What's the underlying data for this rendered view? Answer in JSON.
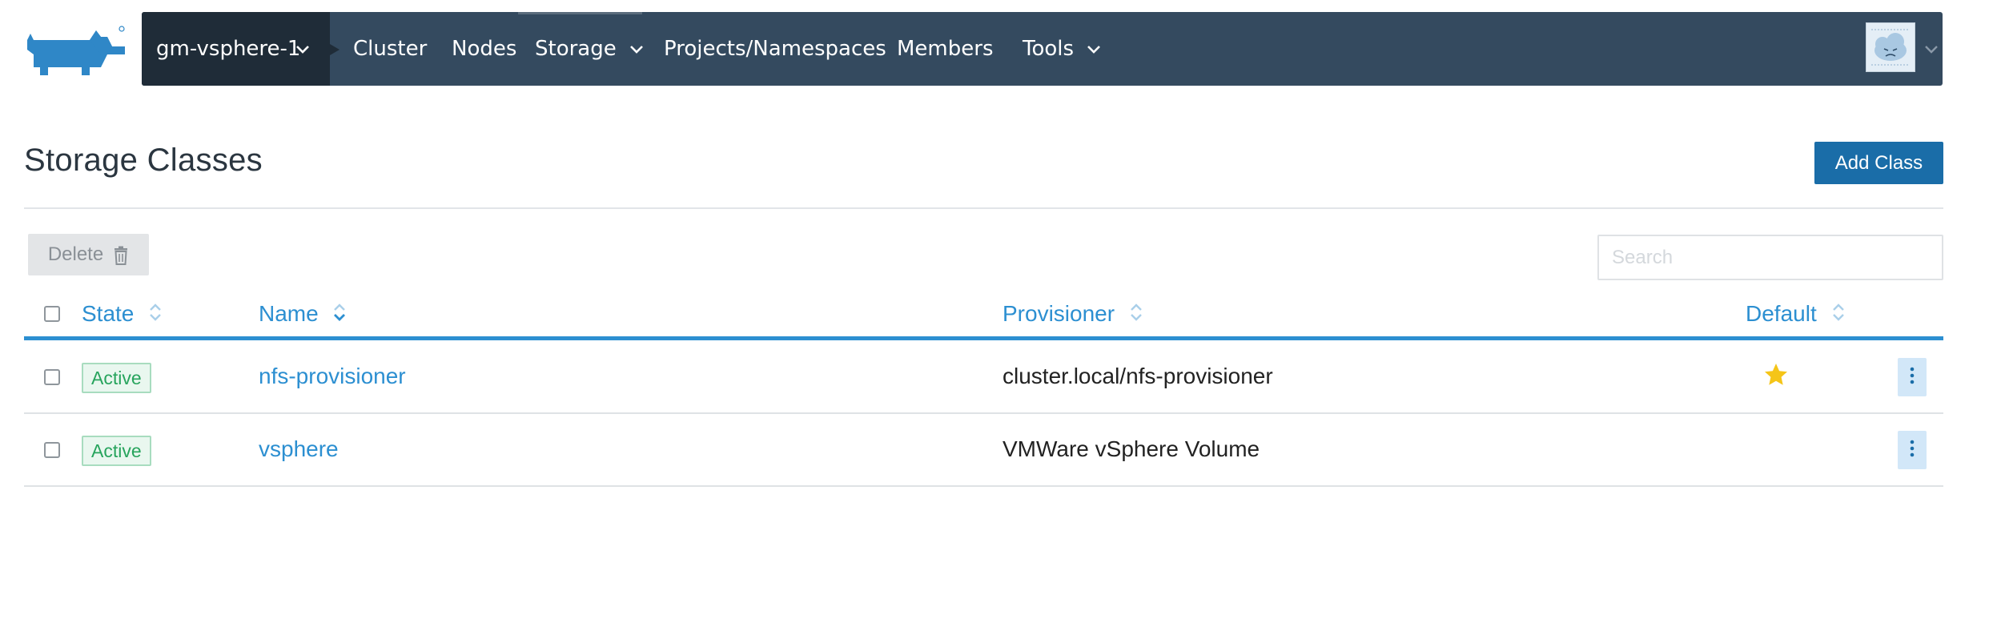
{
  "nav": {
    "cluster": "gm-vsphere-1",
    "items": [
      "Cluster",
      "Nodes",
      "Storage",
      "Projects/Namespaces",
      "Members",
      "Tools"
    ]
  },
  "page": {
    "title": "Storage Classes",
    "add_button": "Add Class",
    "delete_button": "Delete",
    "search_placeholder": "Search"
  },
  "table": {
    "columns": [
      "State",
      "Name",
      "Provisioner",
      "Default"
    ],
    "rows": [
      {
        "state": "Active",
        "name": "nfs-provisioner",
        "provisioner": "cluster.local/nfs-provisioner",
        "default": true
      },
      {
        "state": "Active",
        "name": "vsphere",
        "provisioner": "VMWare vSphere Volume",
        "default": false
      }
    ]
  },
  "colors": {
    "nav_bg": "#344a5f",
    "nav_active": "#1f2c38",
    "accent": "#2c8fd1",
    "primary_button": "#1a6da8",
    "active_badge": "#27a45d",
    "default_star": "#f5c518"
  },
  "icons": [
    "rancher-logo",
    "chevron-down-icon",
    "trash-icon",
    "sort-icon",
    "star-icon",
    "kebab-menu-icon",
    "user-avatar"
  ]
}
